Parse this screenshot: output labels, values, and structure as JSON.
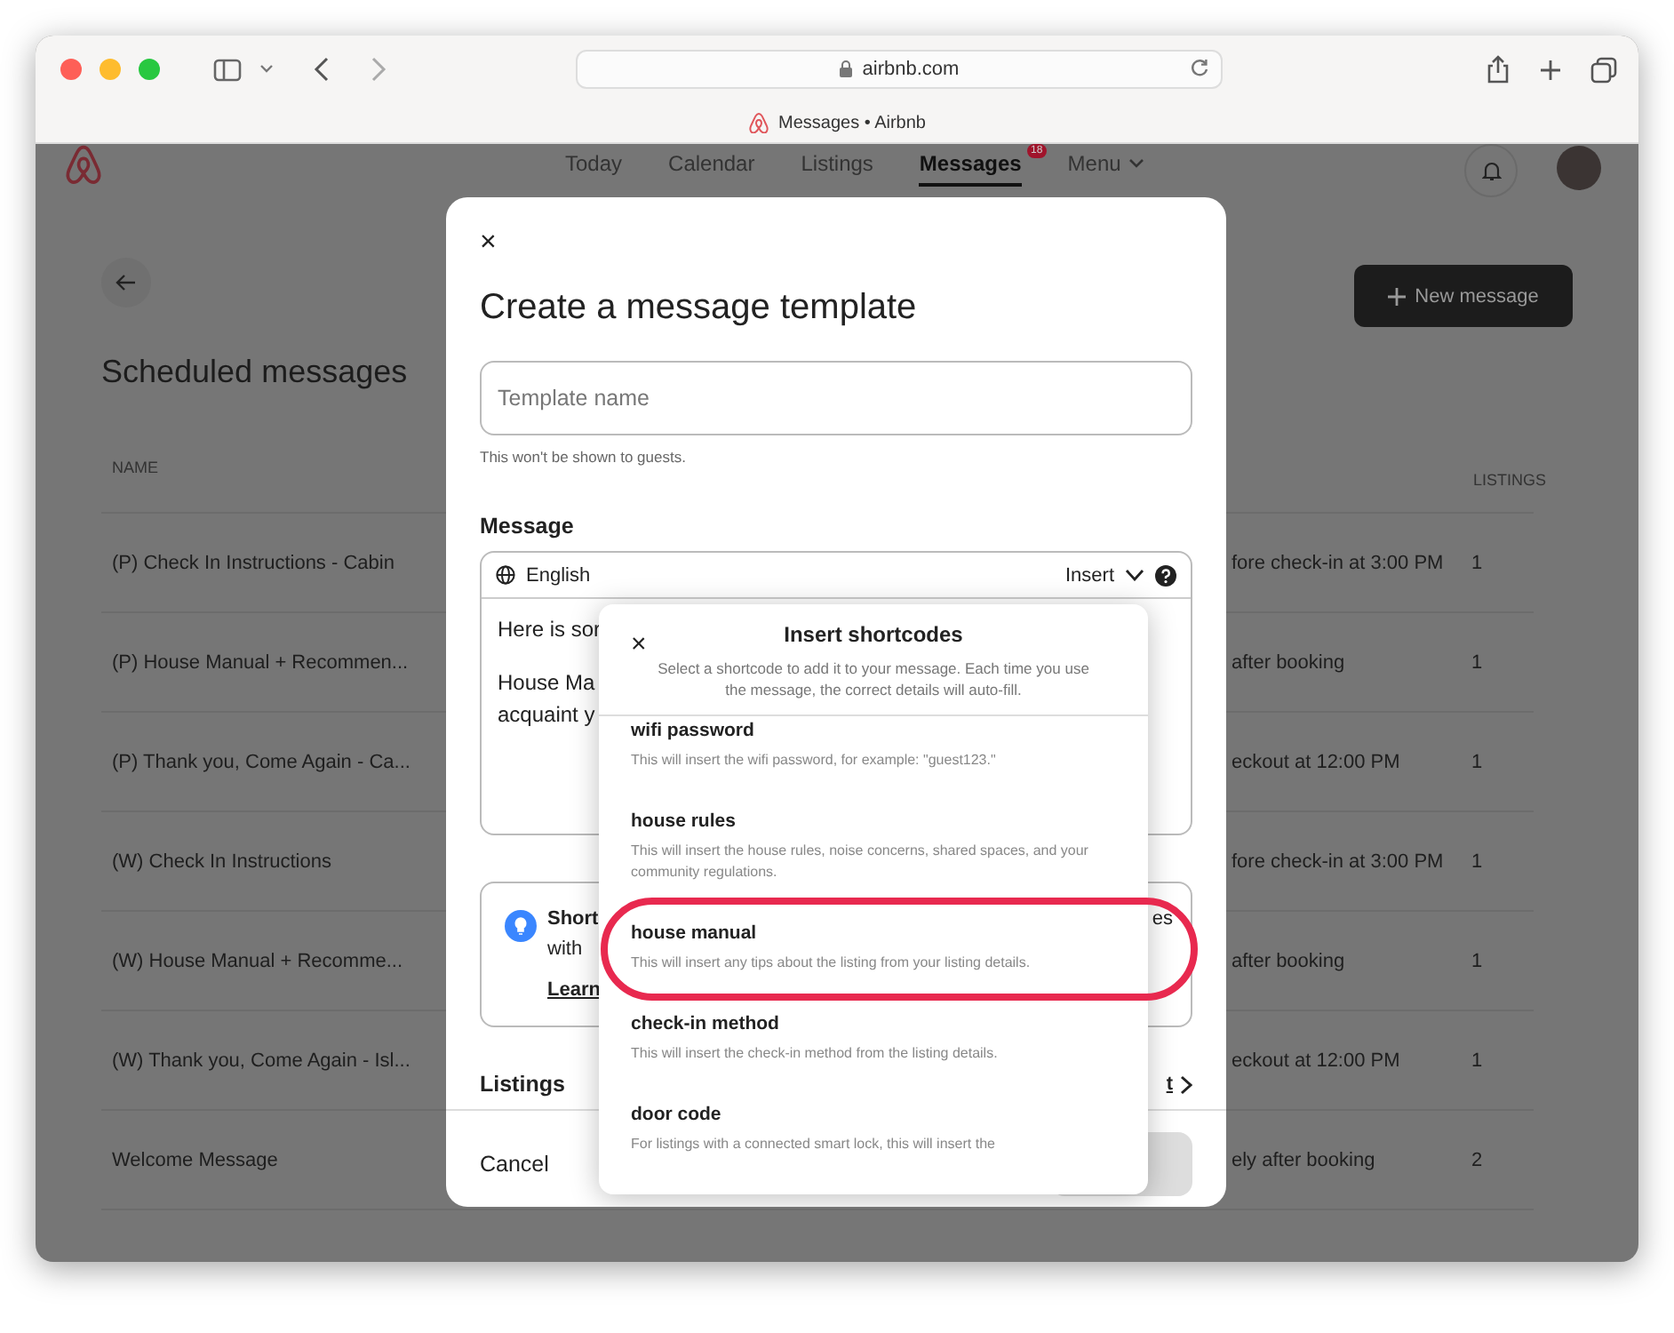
{
  "browser": {
    "url": "airbnb.com",
    "tab_title": "Messages • Airbnb"
  },
  "nav": {
    "items": [
      {
        "label": "Today",
        "selected": false
      },
      {
        "label": "Calendar",
        "selected": false
      },
      {
        "label": "Listings",
        "selected": false
      },
      {
        "label": "Messages",
        "selected": true
      },
      {
        "label": "Menu",
        "selected": false
      }
    ],
    "badge": "18"
  },
  "page": {
    "title": "Scheduled messages",
    "new_button": "New message",
    "columns": {
      "name": "NAME",
      "listings": "LISTINGS"
    },
    "rows": [
      {
        "name": "(P) Check In Instructions - Cabin",
        "trigger": "fore check-in at 3:00 PM",
        "listings": "1"
      },
      {
        "name": "(P) House Manual + Recommen...",
        "trigger": "after booking",
        "listings": "1"
      },
      {
        "name": "(P) Thank you, Come Again - Ca...",
        "trigger": "eckout at 12:00 PM",
        "listings": "1"
      },
      {
        "name": "(W) Check In Instructions",
        "trigger": "fore check-in at 3:00 PM",
        "listings": "1"
      },
      {
        "name": "(W) House Manual + Recomme...",
        "trigger": "after booking",
        "listings": "1"
      },
      {
        "name": "(W) Thank you, Come Again - Isl...",
        "trigger": "eckout at 12:00 PM",
        "listings": "1"
      },
      {
        "name": "Welcome Message",
        "trigger": "ely after booking",
        "listings": "2"
      }
    ]
  },
  "modal": {
    "title": "Create a message template",
    "name_placeholder": "Template name",
    "name_hint": "This won't be shown to guests.",
    "message_label": "Message",
    "language": "English",
    "insert_label": "Insert",
    "body_fragments": [
      "Here is sor",
      "House Ma",
      "acquaint y"
    ],
    "tip": {
      "title": "Short",
      "line2": "with",
      "link": "Learn",
      "right": "es"
    },
    "listings_label": "Listings",
    "listings_action": "t",
    "cancel": "Cancel",
    "close_glyph": "×"
  },
  "shortcodes": {
    "close_glyph": "×",
    "title": "Insert shortcodes",
    "description": "Select a shortcode to add it to your message. Each time you use the message, the correct details will auto-fill.",
    "items": [
      {
        "title": "wifi password",
        "description": "This will insert the wifi password, for example: \"guest123.\""
      },
      {
        "title": "house rules",
        "description": "This will insert the house rules, noise concerns, shared spaces, and your community regulations."
      },
      {
        "title": "house manual",
        "description": "This will insert any tips about the listing from your listing details."
      },
      {
        "title": "check-in method",
        "description": "This will insert the check-in method from the listing details."
      },
      {
        "title": "door code",
        "description": "For listings with a connected smart lock, this will insert the"
      }
    ]
  }
}
